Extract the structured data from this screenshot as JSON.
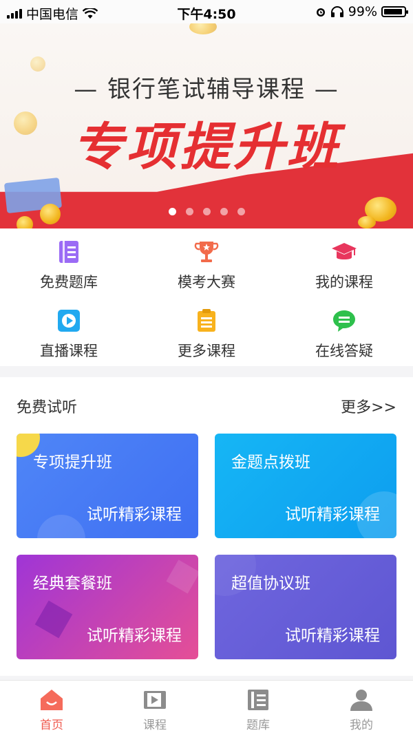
{
  "status_bar": {
    "carrier": "中国电信",
    "time": "下午4:50",
    "battery": "99%"
  },
  "banner": {
    "subtitle": "— 银行笔试辅导课程 —",
    "title": "专项提升班",
    "slide_count": 5,
    "active_slide": 1
  },
  "menu": [
    {
      "label": "免费题库",
      "icon": "book-icon",
      "color": "#9b6bf5"
    },
    {
      "label": "模考大赛",
      "icon": "trophy-icon",
      "color": "#f26b4b"
    },
    {
      "label": "我的课程",
      "icon": "graduation-cap-icon",
      "color": "#e8365d"
    },
    {
      "label": "直播课程",
      "icon": "play-icon",
      "color": "#21a9f0"
    },
    {
      "label": "更多课程",
      "icon": "clipboard-icon",
      "color": "#f8b21d"
    },
    {
      "label": "在线答疑",
      "icon": "chat-bubble-icon",
      "color": "#2ec04c"
    }
  ],
  "free_trial": {
    "title": "免费试听",
    "more": "更多>>",
    "cards": [
      {
        "title": "专项提升班",
        "subtitle": "试听精彩课程",
        "color": "#4a7cf6"
      },
      {
        "title": "金题点拨班",
        "subtitle": "试听精彩课程",
        "color": "#12a9f3"
      },
      {
        "title": "经典套餐班",
        "subtitle": "试听精彩课程",
        "color": "#b43fd3"
      },
      {
        "title": "超值协议班",
        "subtitle": "试听精彩课程",
        "color": "#6a5fd8"
      }
    ]
  },
  "tabbar": [
    {
      "label": "首页",
      "icon": "home-icon",
      "active": true
    },
    {
      "label": "课程",
      "icon": "video-icon",
      "active": false
    },
    {
      "label": "题库",
      "icon": "question-bank-icon",
      "active": false
    },
    {
      "label": "我的",
      "icon": "user-icon",
      "active": false
    }
  ]
}
